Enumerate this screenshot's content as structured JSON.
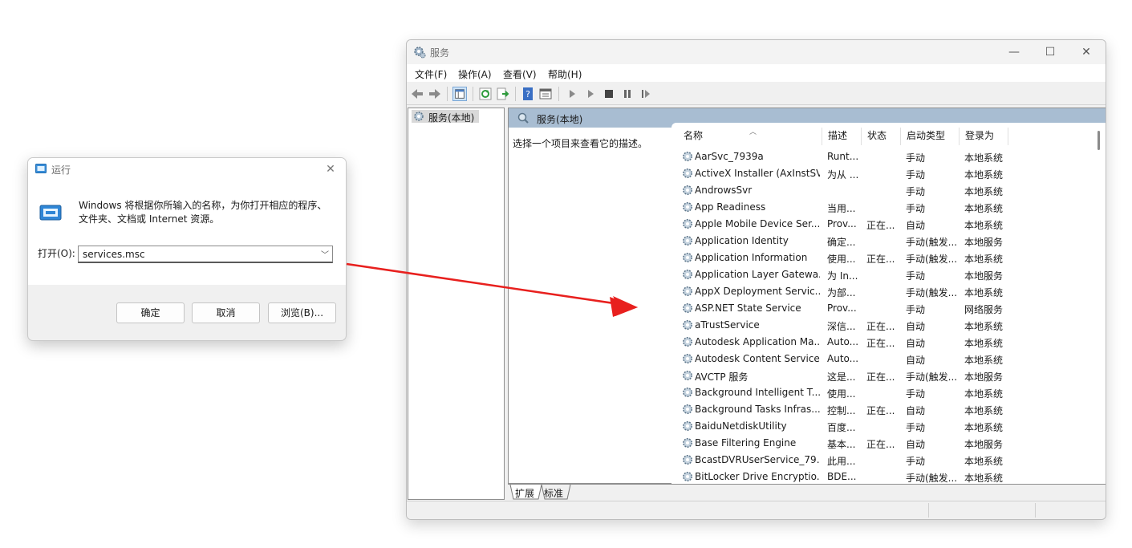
{
  "run_dialog": {
    "title": "运行",
    "description": "Windows 将根据你所输入的名称，为你打开相应的程序、文件夹、文档或 Internet 资源。",
    "open_label": "打开(O):",
    "open_value": "services.msc",
    "ok_label": "确定",
    "cancel_label": "取消",
    "browse_label": "浏览(B)...",
    "close_icon": "close-icon"
  },
  "services_window": {
    "title": "服务",
    "menu": [
      "文件(F)",
      "操作(A)",
      "查看(V)",
      "帮助(H)"
    ],
    "tree_item": "服务(本地)",
    "panel_title": "服务(本地)",
    "select_hint": "选择一个项目来查看它的描述。",
    "columns": [
      "名称",
      "描述",
      "状态",
      "启动类型",
      "登录为"
    ],
    "rows": [
      {
        "name": "AarSvc_7939a",
        "desc": "Runt...",
        "status": "",
        "startup": "手动",
        "logon": "本地系统"
      },
      {
        "name": "ActiveX Installer (AxInstSV)",
        "desc": "为从 ...",
        "status": "",
        "startup": "手动",
        "logon": "本地系统"
      },
      {
        "name": "AndrowsSvr",
        "desc": "",
        "status": "",
        "startup": "手动",
        "logon": "本地系统"
      },
      {
        "name": "App Readiness",
        "desc": "当用...",
        "status": "",
        "startup": "手动",
        "logon": "本地系统"
      },
      {
        "name": "Apple Mobile Device Ser...",
        "desc": "Prov...",
        "status": "正在...",
        "startup": "自动",
        "logon": "本地系统"
      },
      {
        "name": "Application Identity",
        "desc": "确定...",
        "status": "",
        "startup": "手动(触发...",
        "logon": "本地服务"
      },
      {
        "name": "Application Information",
        "desc": "使用...",
        "status": "正在...",
        "startup": "手动(触发...",
        "logon": "本地系统"
      },
      {
        "name": "Application Layer Gatewa...",
        "desc": "为 In...",
        "status": "",
        "startup": "手动",
        "logon": "本地服务"
      },
      {
        "name": "AppX Deployment Servic...",
        "desc": "为部...",
        "status": "",
        "startup": "手动(触发...",
        "logon": "本地系统"
      },
      {
        "name": "ASP.NET State Service",
        "desc": "Prov...",
        "status": "",
        "startup": "手动",
        "logon": "网络服务"
      },
      {
        "name": "aTrustService",
        "desc": "深信...",
        "status": "正在...",
        "startup": "自动",
        "logon": "本地系统"
      },
      {
        "name": "Autodesk Application Ma...",
        "desc": "Auto...",
        "status": "正在...",
        "startup": "自动",
        "logon": "本地系统"
      },
      {
        "name": "Autodesk Content Service",
        "desc": "Auto...",
        "status": "",
        "startup": "自动",
        "logon": "本地系统"
      },
      {
        "name": "AVCTP 服务",
        "desc": "这是...",
        "status": "正在...",
        "startup": "手动(触发...",
        "logon": "本地服务"
      },
      {
        "name": "Background Intelligent T...",
        "desc": "使用...",
        "status": "",
        "startup": "手动",
        "logon": "本地系统"
      },
      {
        "name": "Background Tasks Infras...",
        "desc": "控制...",
        "status": "正在...",
        "startup": "自动",
        "logon": "本地系统"
      },
      {
        "name": "BaiduNetdiskUtility",
        "desc": "百度...",
        "status": "",
        "startup": "手动",
        "logon": "本地系统"
      },
      {
        "name": "Base Filtering Engine",
        "desc": "基本...",
        "status": "正在...",
        "startup": "自动",
        "logon": "本地服务"
      },
      {
        "name": "BcastDVRUserService_79...",
        "desc": "此用...",
        "status": "",
        "startup": "手动",
        "logon": "本地系统"
      },
      {
        "name": "BitLocker Drive Encryptio...",
        "desc": "BDE...",
        "status": "",
        "startup": "手动(触发...",
        "logon": "本地系统"
      }
    ],
    "tabs": [
      "扩展",
      "标准"
    ],
    "toolbar_icons": [
      "back-icon",
      "forward-icon",
      "show-hide-console-tree-icon",
      "refresh-icon",
      "export-list-icon",
      "help-icon",
      "properties-icon",
      "start-service-icon",
      "start-service-alt-icon",
      "stop-service-icon",
      "pause-service-icon",
      "restart-service-icon"
    ]
  },
  "colors": {
    "panel_header": "#a8bdd2",
    "arrow": "#e8201e"
  }
}
